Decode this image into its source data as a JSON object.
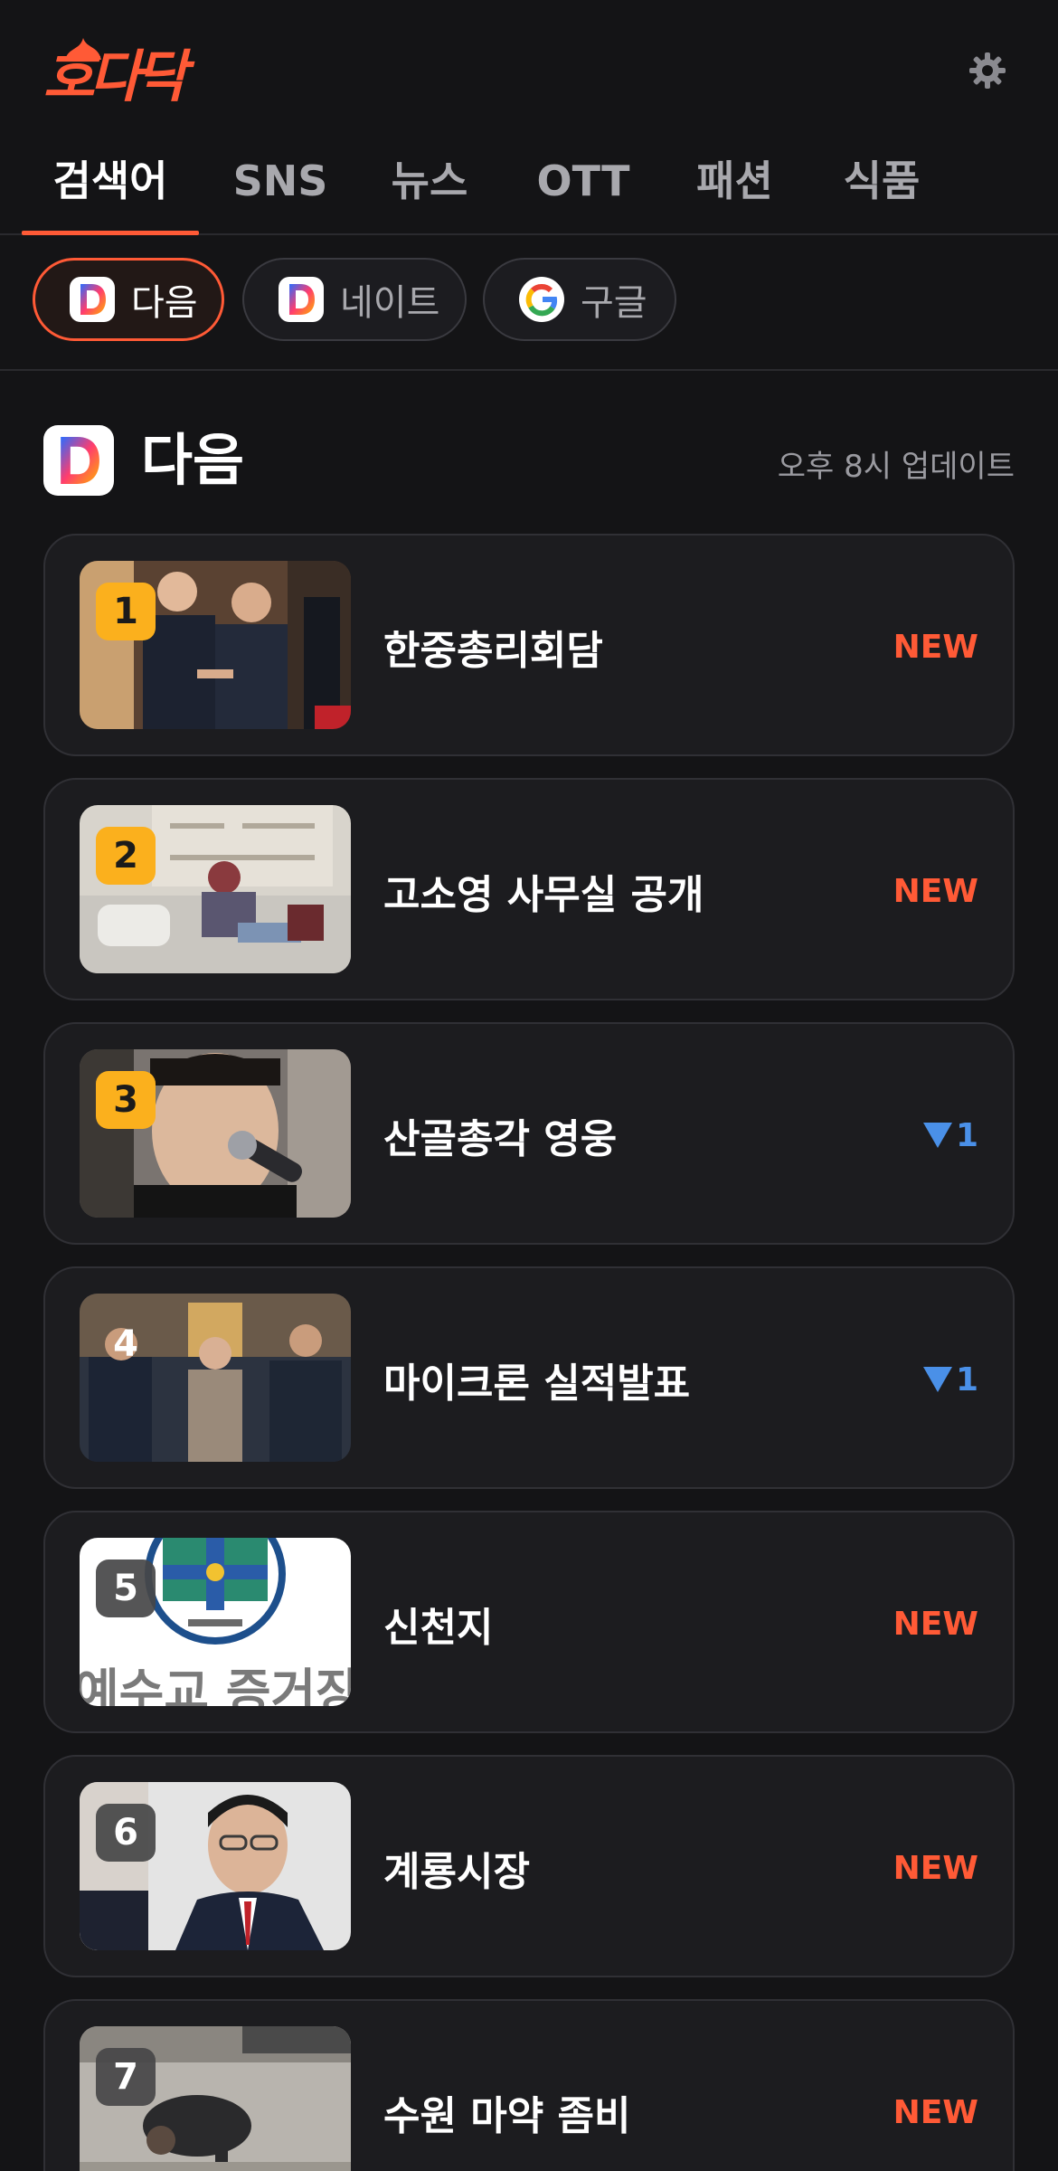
{
  "app": {
    "logo_text": "호다닥"
  },
  "icons": {
    "settings": "gear-icon",
    "daum": "daum-logo-icon",
    "nate": "nate-logo-icon",
    "google": "google-logo-icon"
  },
  "colors": {
    "accent": "#ff5a36",
    "rank_top": "#fbb01d",
    "down": "#4a90e8",
    "background": "#141416"
  },
  "tabs": [
    {
      "label": "검색어",
      "active": true
    },
    {
      "label": "SNS"
    },
    {
      "label": "뉴스"
    },
    {
      "label": "OTT"
    },
    {
      "label": "패션"
    },
    {
      "label": "식품"
    }
  ],
  "sources": [
    {
      "label": "다음",
      "active": true,
      "icon": "daum-logo-icon"
    },
    {
      "label": "네이트",
      "icon": "nate-logo-icon"
    },
    {
      "label": "구글",
      "icon": "google-logo-icon"
    }
  ],
  "section": {
    "title": "다음",
    "updated": "오후 8시 업데이트"
  },
  "items": [
    {
      "rank": "1",
      "title": "한중총리회담",
      "status": "NEW",
      "thumb": "two men shaking hands"
    },
    {
      "rank": "2",
      "title": "고소영 사무실 공개",
      "status": "NEW",
      "thumb": "woman on sofa"
    },
    {
      "rank": "3",
      "title": "산골총각 영웅",
      "status": "1",
      "direction": "down",
      "thumb": "singer with microphone"
    },
    {
      "rank": "4",
      "title": "마이크론 실적발표",
      "status": "1",
      "direction": "down",
      "thumb": "people with phones"
    },
    {
      "rank": "5",
      "title": "신천지",
      "status": "NEW",
      "thumb": "emblem",
      "thumb_text": "예수교 증거장"
    },
    {
      "rank": "6",
      "title": "계룡시장",
      "status": "NEW",
      "thumb": "man portrait"
    },
    {
      "rank": "7",
      "title": "수원 마약 좀비",
      "status": "NEW",
      "thumb": "street scene"
    }
  ]
}
